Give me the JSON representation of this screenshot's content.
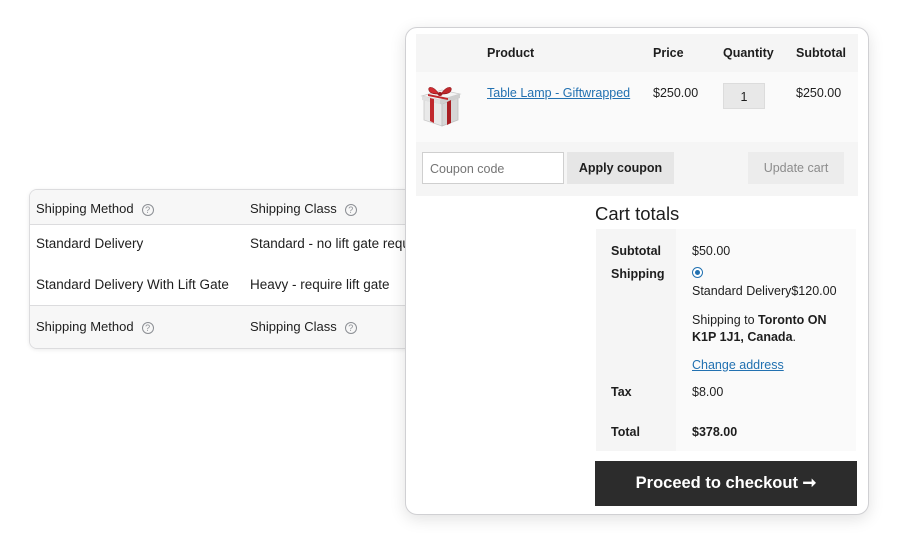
{
  "shipping_table": {
    "header": {
      "col1": "Shipping Method",
      "col2": "Shipping Class"
    },
    "rows": [
      {
        "method": "Standard Delivery",
        "class": "Standard - no lift gate required"
      },
      {
        "method": "Standard Delivery With Lift Gate",
        "class": "Heavy - require lift gate"
      }
    ],
    "footer": {
      "col1": "Shipping Method",
      "col2": "Shipping Class"
    },
    "help_icon_glyph": "?"
  },
  "cart": {
    "columns": {
      "product": "Product",
      "price": "Price",
      "quantity": "Quantity",
      "subtotal": "Subtotal"
    },
    "item": {
      "name": "Table Lamp - Giftwrapped",
      "price": "$250.00",
      "quantity": "1",
      "subtotal": "$250.00",
      "image_icon": "gift-box-icon"
    },
    "coupon": {
      "placeholder": "Coupon code",
      "apply_label": "Apply coupon"
    },
    "update_label": "Update cart"
  },
  "totals": {
    "title": "Cart totals",
    "subtotal_label": "Subtotal",
    "subtotal_value": "$50.00",
    "shipping_label": "Shipping",
    "shipping_option": "Standard Delivery",
    "shipping_option_price": "$120.00",
    "shipping_to_prefix": "Shipping to ",
    "shipping_to_location": "Toronto ON K1P 1J1, Canada",
    "shipping_to_suffix": ".",
    "change_address": "Change address",
    "tax_label": "Tax",
    "tax_value": "$8.00",
    "total_label": "Total",
    "total_value": "$378.00",
    "checkout_label": "Proceed to checkout",
    "checkout_arrow": "➞"
  },
  "colors": {
    "link": "#2271b1",
    "checkout_bg": "#2c2c2c"
  }
}
